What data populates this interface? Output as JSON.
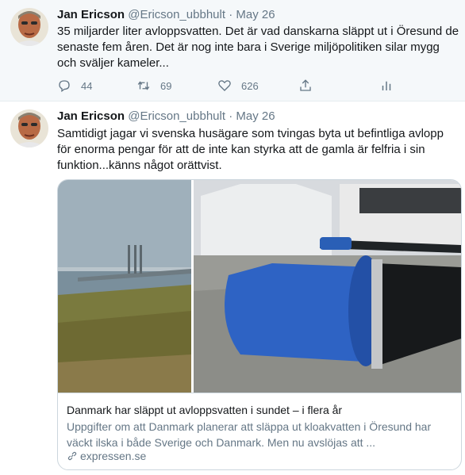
{
  "tweets": [
    {
      "author_name": "Jan Ericson",
      "handle": "@Ericson_ubbhult",
      "separator": "·",
      "date": "May 26",
      "text": "35 miljarder liter avloppsvatten. Det är vad danskarna släppt ut i Öresund de senaste fem åren. Det är nog inte bara i Sverige miljöpolitiken silar mygg och sväljer kameler...",
      "replies": "44",
      "retweets": "69",
      "likes": "626"
    },
    {
      "author_name": "Jan Ericson",
      "handle": "@Ericson_ubbhult",
      "separator": "·",
      "date": "May 26",
      "text": "Samtidigt jagar vi svenska husägare som tvingas byta ut befintliga avlopp för enorma pengar för att de inte kan styrka att de gamla är felfria i sin funktion...känns något orättvist.",
      "card": {
        "title": "Danmark har släppt ut avloppsvatten i sundet – i flera år",
        "description": "Uppgifter om att Danmark planerar att släppa ut kloakvatten i Öresund har väckt ilska i både Sverige och Danmark. Men nu avslöjas att ...",
        "domain": "expressen.se"
      }
    }
  ],
  "colors": {
    "text": "#14171a",
    "secondary": "#657786",
    "border": "#e6ecf0",
    "highlight_bg": "#f5f8fa"
  },
  "icons": [
    "reply-icon",
    "retweet-icon",
    "like-icon",
    "share-icon",
    "analytics-icon",
    "link-icon"
  ]
}
